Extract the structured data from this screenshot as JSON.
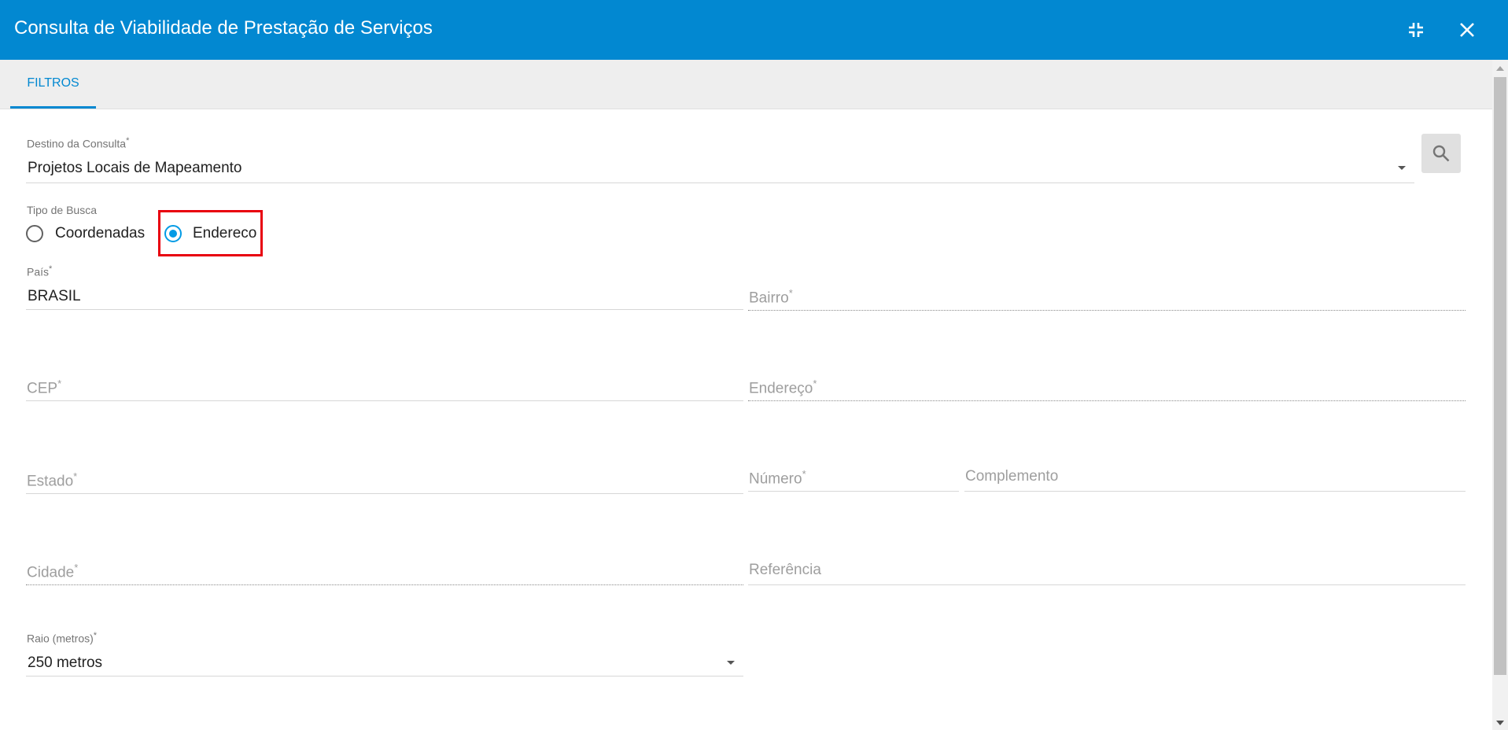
{
  "window": {
    "title": "Consulta de Viabilidade de Prestação de Serviços",
    "minimize_icon": "collapse-icon",
    "close_icon": "close-icon",
    "accent_color": "#0288d1"
  },
  "tabs": [
    {
      "label": "FILTROS",
      "active": true
    }
  ],
  "form": {
    "destino": {
      "label": "Destino da Consulta",
      "required_mark": "*",
      "value": "Projetos Locais de Mapeamento"
    },
    "search_button_icon": "search-icon",
    "tipo_busca": {
      "label": "Tipo de Busca",
      "options": [
        {
          "label": "Coordenadas",
          "selected": false
        },
        {
          "label": "Endereco",
          "selected": true
        }
      ]
    },
    "pais": {
      "label": "País",
      "required_mark": "*",
      "value": "BRASIL"
    },
    "bairro": {
      "placeholder": "Bairro",
      "required_mark": "*"
    },
    "cep": {
      "placeholder": "CEP",
      "required_mark": "*"
    },
    "endereco": {
      "placeholder": "Endereço",
      "required_mark": "*"
    },
    "estado": {
      "placeholder": "Estado",
      "required_mark": "*"
    },
    "numero": {
      "placeholder": "Número",
      "required_mark": "*"
    },
    "complemento": {
      "placeholder": "Complemento"
    },
    "cidade": {
      "placeholder": "Cidade",
      "required_mark": "*"
    },
    "referencia": {
      "placeholder": "Referência"
    },
    "raio": {
      "label": "Raio (metros)",
      "required_mark": "*",
      "value": "250 metros"
    }
  },
  "highlight_color": "#e8000f"
}
